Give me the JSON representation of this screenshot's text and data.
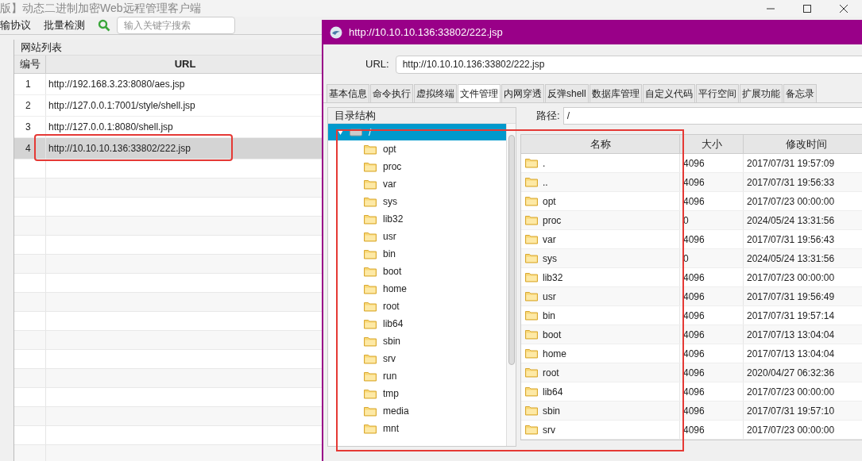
{
  "main_window": {
    "title": "版】动态二进制加密Web远程管理客户端",
    "toolbar": {
      "items": [
        "输协议",
        "批量检测"
      ],
      "search": {
        "placeholder": "输入关键字搜索"
      }
    },
    "site_list": {
      "title": "网站列表",
      "columns": [
        "编号",
        "URL"
      ],
      "rows": [
        {
          "number": "1",
          "url": "http://192.168.3.23:8080/aes.jsp",
          "selected": false
        },
        {
          "number": "2",
          "url": "http://127.0.0.1:7001/style/shell.jsp",
          "selected": false
        },
        {
          "number": "3",
          "url": "http://127.0.0.1:8080/shell.jsp",
          "selected": false
        },
        {
          "number": "4",
          "url": "http://10.10.10.136:33802/222.jsp",
          "selected": true
        }
      ]
    }
  },
  "dialog": {
    "title": "http://10.10.10.136:33802/222.jsp",
    "url_label": "URL:",
    "url": "http://10.10.10.136:33802/222.jsp",
    "tabs": [
      {
        "label": "基本信息",
        "selected": false
      },
      {
        "label": "命令执行",
        "selected": false
      },
      {
        "label": "虚拟终端",
        "selected": false
      },
      {
        "label": "文件管理",
        "selected": true
      },
      {
        "label": "内网穿透",
        "selected": false
      },
      {
        "label": "反弹shell",
        "selected": false
      },
      {
        "label": "数据库管理",
        "selected": false
      },
      {
        "label": "自定义代码",
        "selected": false
      },
      {
        "label": "平行空间",
        "selected": false
      },
      {
        "label": "扩展功能",
        "selected": false
      },
      {
        "label": "备忘录",
        "selected": false
      }
    ],
    "tree": {
      "title": "目录结构",
      "root": {
        "label": "/",
        "expanded": true,
        "selected": true,
        "children": [
          {
            "label": "opt"
          },
          {
            "label": "proc"
          },
          {
            "label": "var"
          },
          {
            "label": "sys"
          },
          {
            "label": "lib32"
          },
          {
            "label": "usr"
          },
          {
            "label": "bin"
          },
          {
            "label": "boot"
          },
          {
            "label": "home"
          },
          {
            "label": "root"
          },
          {
            "label": "lib64"
          },
          {
            "label": "sbin"
          },
          {
            "label": "srv"
          },
          {
            "label": "run"
          },
          {
            "label": "tmp"
          },
          {
            "label": "media"
          },
          {
            "label": "mnt"
          }
        ]
      }
    },
    "path_label": "路径:",
    "path": "/",
    "files": {
      "columns": [
        "名称",
        "大小",
        "修改时间"
      ],
      "rows": [
        {
          "name": ".",
          "size": "4096",
          "modified": "2017/07/31 19:57:09"
        },
        {
          "name": "..",
          "size": "4096",
          "modified": "2017/07/31 19:56:33"
        },
        {
          "name": "opt",
          "size": "4096",
          "modified": "2017/07/23 00:00:00"
        },
        {
          "name": "proc",
          "size": "0",
          "modified": "2024/05/24 13:31:56"
        },
        {
          "name": "var",
          "size": "4096",
          "modified": "2017/07/31 19:56:43"
        },
        {
          "name": "sys",
          "size": "0",
          "modified": "2024/05/24 13:31:56"
        },
        {
          "name": "lib32",
          "size": "4096",
          "modified": "2017/07/23 00:00:00"
        },
        {
          "name": "usr",
          "size": "4096",
          "modified": "2017/07/31 19:56:49"
        },
        {
          "name": "bin",
          "size": "4096",
          "modified": "2017/07/31 19:57:14"
        },
        {
          "name": "boot",
          "size": "4096",
          "modified": "2017/07/13 13:04:04"
        },
        {
          "name": "home",
          "size": "4096",
          "modified": "2017/07/13 13:04:04"
        },
        {
          "name": "root",
          "size": "4096",
          "modified": "2020/04/27 06:32:36"
        },
        {
          "name": "lib64",
          "size": "4096",
          "modified": "2017/07/23 00:00:00"
        },
        {
          "name": "sbin",
          "size": "4096",
          "modified": "2017/07/31 19:57:10"
        },
        {
          "name": "srv",
          "size": "4096",
          "modified": "2017/07/23 00:00:00"
        }
      ]
    }
  }
}
